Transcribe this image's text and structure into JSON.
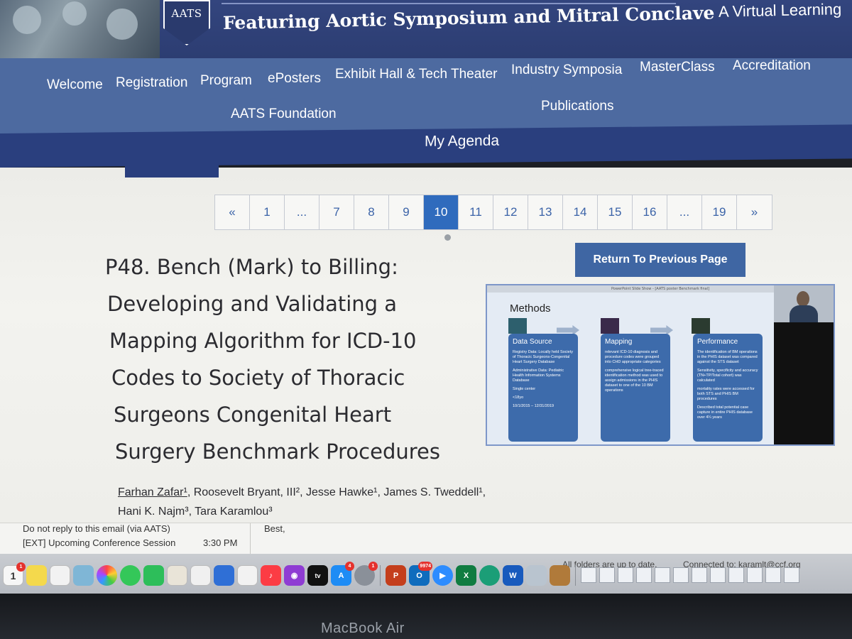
{
  "header": {
    "logo_text": "AATS",
    "title": "Featuring Aortic Symposium and Mitral Conclave",
    "subtitle": "A Virtual Learning"
  },
  "nav": {
    "items": [
      "Welcome",
      "Registration",
      "Program",
      "ePosters",
      "Exhibit Hall & Tech Theater",
      "Industry Symposia",
      "MasterClass",
      "Accreditation"
    ],
    "row2": [
      "AATS Foundation",
      "Publications"
    ],
    "agenda": "My Agenda"
  },
  "pagination": {
    "prev": "«",
    "next": "»",
    "pages": [
      "1",
      "...",
      "7",
      "8",
      "9",
      "10",
      "11",
      "12",
      "13",
      "14",
      "15",
      "16",
      "...",
      "19"
    ],
    "active": "10"
  },
  "poster": {
    "title_lines": [
      "P48. Bench (Mark) to Billing:",
      "Developing and Validating a",
      "Mapping Algorithm for ICD-10",
      "Codes to Society of Thoracic",
      "Surgeons Congenital Heart",
      "Surgery Benchmark Procedures"
    ],
    "first_author": "Farhan Zafar¹",
    "authors_rest": ", Roosevelt Bryant, III², Jesse Hawke¹, James S. Tweddell¹, Hani K. Najm³, Tara Karamlou³"
  },
  "return_button": "Return To Previous Page",
  "slide": {
    "window_title": "PowerPoint Slide Show - [AATS poster Benchmark final]",
    "heading": "Methods",
    "columns": [
      {
        "title": "Data Source",
        "items": [
          "Registry Data: Locally held Society of Thoracic Surgeons-Congenital Heart Surgery Database",
          "Administrative Data: Pediatric Health Information Systems Database",
          "Single center",
          "<18yo",
          "10/1/2015 – 12/31/2019"
        ]
      },
      {
        "title": "Mapping",
        "items": [
          "relevant ICD-10 diagnosis and procedure codes were grouped into CHD appropriate categories",
          "comprehensive logical tree-traced identification method was used to assign admissions in the PHIS dataset to one of the 10 BM operations"
        ]
      },
      {
        "title": "Performance",
        "items": [
          "The identification of BM operations in the PHIS dataset was compared against the STS dataset",
          "Sensitivity, specificity and accuracy (TN+TP/Total cohort) was calculated",
          "mortality rates were accessed for both STS and PHIS BM procedures",
          "Described total potential case capture in entire PHIS database over 4¼ years"
        ]
      }
    ]
  },
  "email": {
    "line1": "Do not reply to this email  (via AATS)",
    "line2": "[EXT] Upcoming Conference Session",
    "time": "3:30 PM",
    "body_start": "Best,"
  },
  "status": {
    "folders": "All folders are up to date.",
    "connection": "Connected to: karamlt@ccf.org"
  },
  "dock": {
    "calendar_day": "1",
    "badges": {
      "calendar": "1",
      "appstore": "4",
      "system": "1",
      "outlook": "9974"
    },
    "colors": {
      "powerpoint": "#c43e1c",
      "outlook": "#0f6cbd",
      "excel": "#107c41",
      "word": "#185abd",
      "zoom": "#2d8cff"
    }
  },
  "bezel_label": "MacBook Air"
}
